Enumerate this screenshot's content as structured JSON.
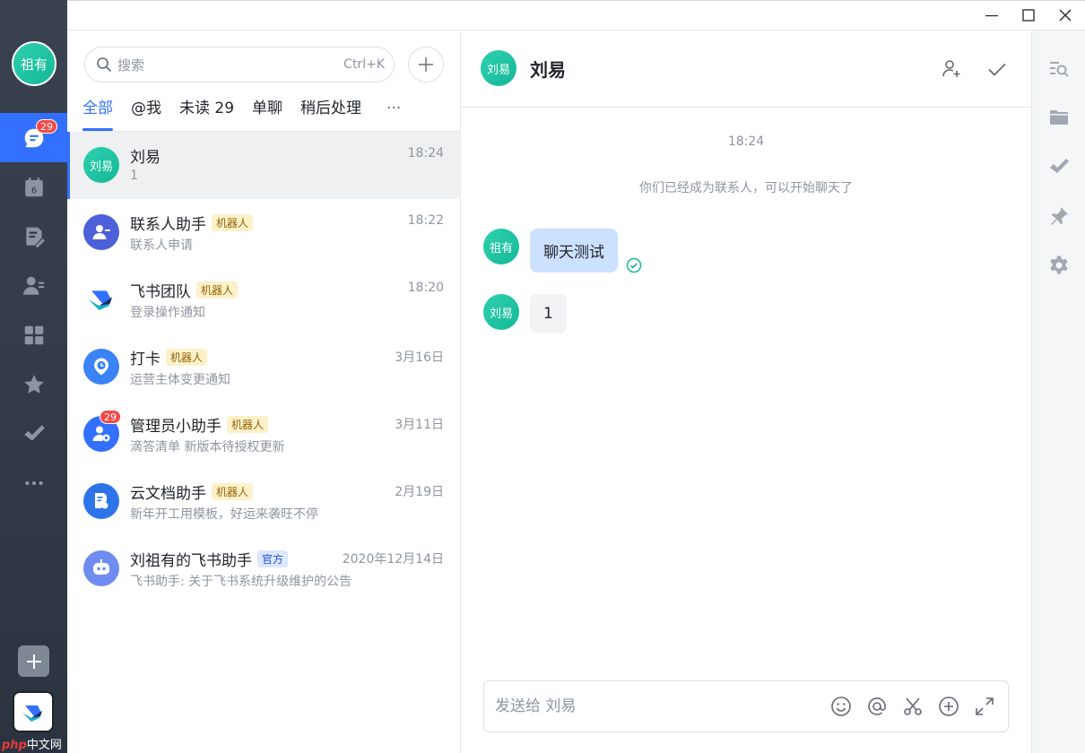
{
  "window": {
    "controls": [
      "minimize",
      "maximize",
      "close"
    ]
  },
  "rail": {
    "user_avatar": "祖有",
    "items": [
      {
        "name": "messenger",
        "icon": "chat-bubble-icon",
        "badge": "29",
        "active": true
      },
      {
        "name": "calendar",
        "icon": "calendar-icon",
        "calendar_day": "6"
      },
      {
        "name": "docs",
        "icon": "doc-edit-icon"
      },
      {
        "name": "contacts",
        "icon": "contacts-icon"
      },
      {
        "name": "workplace",
        "icon": "apps-grid-icon"
      },
      {
        "name": "favorites",
        "icon": "star-icon"
      },
      {
        "name": "approval",
        "icon": "check-icon"
      },
      {
        "name": "more",
        "icon": "more-dots-icon"
      }
    ],
    "add_icon": "plus-icon",
    "app_icon": "feishu-logo-icon"
  },
  "watermark": {
    "php": "php",
    "site": "中文网"
  },
  "list": {
    "search": {
      "placeholder": "搜索",
      "shortcut": "Ctrl+K"
    },
    "tabs": [
      {
        "label": "全部",
        "active": true
      },
      {
        "label": "@我"
      },
      {
        "label": "未读 29"
      },
      {
        "label": "单聊"
      },
      {
        "label": "稍后处理"
      }
    ],
    "tabs_more": "···",
    "conversations": [
      {
        "name": "刘易",
        "avatar_text": "刘易",
        "subtitle": "1",
        "time": "18:24",
        "tag": "",
        "selected": true
      },
      {
        "name": "联系人助手",
        "avatar_text": "",
        "subtitle": "联系人申请",
        "time": "18:22",
        "tag": "机器人"
      },
      {
        "name": "飞书团队",
        "avatar_text": "",
        "subtitle": "登录操作通知",
        "time": "18:20",
        "tag": "机器人"
      },
      {
        "name": "打卡",
        "avatar_text": "",
        "subtitle": "运营主体变更通知",
        "time": "3月16日",
        "tag": "机器人"
      },
      {
        "name": "管理员小助手",
        "avatar_text": "",
        "subtitle": "滴答清单 新版本待授权更新",
        "time": "3月11日",
        "tag": "机器人",
        "badge": "29"
      },
      {
        "name": "云文档助手",
        "avatar_text": "",
        "subtitle": "新年开工用模板，好运来袭旺不停",
        "time": "2月19日",
        "tag": "机器人"
      },
      {
        "name": "刘祖有的飞书助手",
        "avatar_text": "",
        "subtitle": "飞书助手: 关于飞书系统升级维护的公告",
        "time": "2020年12月14日",
        "tag": "官方"
      }
    ]
  },
  "chat": {
    "title": "刘易",
    "avatar_text": "刘易",
    "timestamp": "18:24",
    "system_note": "你们已经成为联系人，可以开始聊天了",
    "messages": [
      {
        "sender_avatar": "祖有",
        "text": "聊天测试",
        "mine": true
      },
      {
        "sender_avatar": "刘易",
        "text": "1",
        "mine": false
      }
    ],
    "composer_placeholder": "发送给 刘易"
  },
  "colors": {
    "accent": "#3370ff",
    "avatar_teal": "#14b896",
    "badge_red": "#f54a45",
    "robot_tag_bg": "#fdf1c9"
  }
}
